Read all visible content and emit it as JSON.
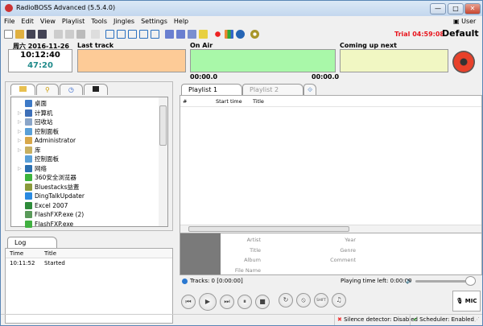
{
  "window": {
    "title": "RadioBOSS Advanced (5.5.4.0)",
    "user": "User",
    "controls": {
      "minimize": "—",
      "maximize": "□",
      "close": "✕"
    }
  },
  "menu": [
    "File",
    "Edit",
    "View",
    "Playlist",
    "Tools",
    "Jingles",
    "Settings",
    "Help"
  ],
  "header": {
    "trial": "Trial 04:59:08",
    "profile": "Default",
    "date": "周六 2016-11-26",
    "clock": "10:12:40",
    "countdown": "47:20",
    "last_track_label": "Last track",
    "on_air_label": "On Air",
    "coming_up_label": "Coming up next",
    "time_left": "00:00.0",
    "time_right": "00:00.0",
    "colors": {
      "last_track": "#fdcb97",
      "on_air": "#a9f8a9",
      "coming_up": "#f1f7c3",
      "trial": "#e8141c",
      "countdown": "#1f8a8a"
    }
  },
  "browser": {
    "tabs": [
      "folder-icon",
      "search-icon",
      "clock-icon",
      "panel-icon"
    ],
    "items": [
      {
        "label": "桌面",
        "expandable": false,
        "color": "#3d7ac7"
      },
      {
        "label": "计算机",
        "expandable": true,
        "color": "#3d6fb8"
      },
      {
        "label": "回收站",
        "expandable": true,
        "color": "#8aa5c8"
      },
      {
        "label": "控制面板",
        "expandable": true,
        "color": "#5aa0d8"
      },
      {
        "label": "Administrator",
        "expandable": true,
        "color": "#d8a84a"
      },
      {
        "label": "库",
        "expandable": true,
        "color": "#c8b060"
      },
      {
        "label": "控制面板",
        "expandable": false,
        "color": "#5aa0d8"
      },
      {
        "label": "网络",
        "expandable": true,
        "color": "#2a6fb0"
      },
      {
        "label": "360安全浏览器",
        "expandable": false,
        "color": "#3cb43c"
      },
      {
        "label": "Bluestacks益蓋",
        "expandable": false,
        "color": "#8a9a3a"
      },
      {
        "label": "DingTalkUpdater",
        "expandable": false,
        "color": "#2a8ae0"
      },
      {
        "label": "Excel 2007",
        "expandable": false,
        "color": "#2e8b3a"
      },
      {
        "label": "FlashFXP.exe (2)",
        "expandable": false,
        "color": "#5a9a5a"
      },
      {
        "label": "FlashFXP.exe",
        "expandable": false,
        "color": "#40b040"
      }
    ]
  },
  "log": {
    "tab": "Log",
    "columns": [
      "Time",
      "Title"
    ],
    "rows": [
      {
        "time": "10:11:52",
        "title": "Started"
      }
    ]
  },
  "playlist": {
    "tabs": [
      "Playlist 1",
      "Playlist 2"
    ],
    "columns": [
      "#",
      "Start time",
      "Title"
    ],
    "meta_labels_left": [
      "Artist",
      "Title",
      "Album",
      "File Name"
    ],
    "meta_labels_right": [
      "Year",
      "Genre",
      "Comment"
    ],
    "tracks": "Tracks: 0 [0:00:00]",
    "playing_left": "Playing time left: 0:00:00",
    "volume": 1.0
  },
  "controls": {
    "buttons": [
      {
        "name": "previous",
        "glyph": "⏮"
      },
      {
        "name": "play",
        "glyph": "▶"
      },
      {
        "name": "next",
        "glyph": "⏭"
      },
      {
        "name": "pause",
        "glyph": "⏸"
      },
      {
        "name": "stop",
        "glyph": "■"
      }
    ],
    "buttons2": [
      {
        "name": "loop",
        "glyph": "↻"
      },
      {
        "name": "no-stop",
        "glyph": "⦸"
      },
      {
        "name": "shift",
        "glyph": "SHIFT"
      },
      {
        "name": "jingle",
        "glyph": "♫"
      }
    ],
    "mic": "MIC"
  },
  "status": {
    "silence": "Silence detector: Disabled",
    "scheduler": "Scheduler: Enabled"
  }
}
